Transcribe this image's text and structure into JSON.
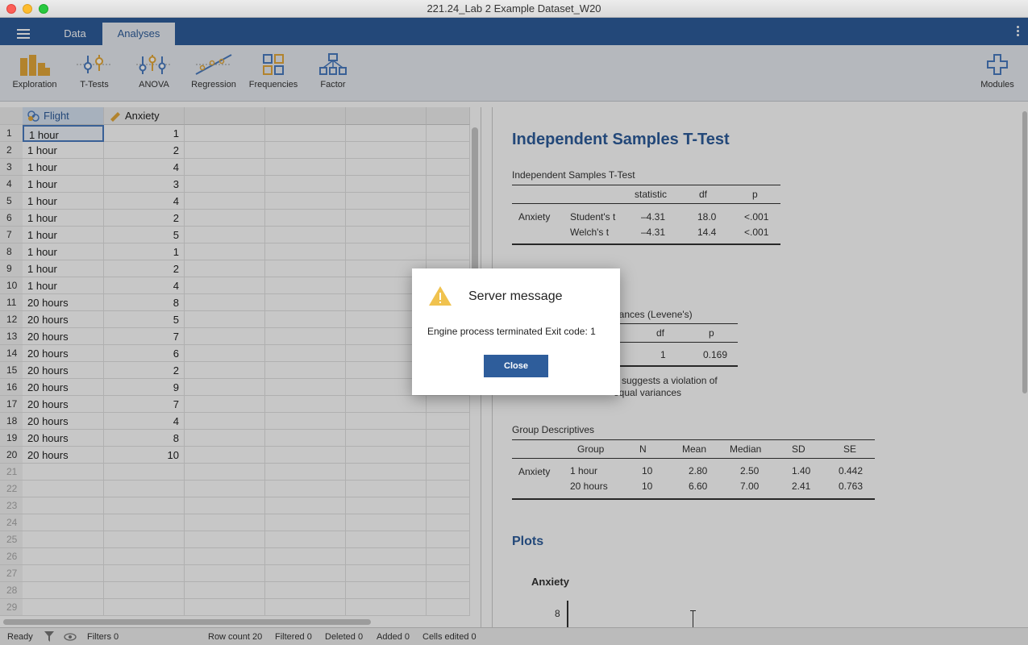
{
  "window": {
    "title": "221.24_Lab 2 Example Dataset_W20"
  },
  "tabs": [
    {
      "label": "Data"
    },
    {
      "label": "Analyses"
    }
  ],
  "ribbon": {
    "exploration": "Exploration",
    "ttests": "T-Tests",
    "anova": "ANOVA",
    "regression": "Regression",
    "frequencies": "Frequencies",
    "factor": "Factor",
    "modules": "Modules"
  },
  "sheet": {
    "columns": [
      "Flight",
      "Anxiety"
    ],
    "rows": [
      [
        "1 hour",
        "1"
      ],
      [
        "1 hour",
        "2"
      ],
      [
        "1 hour",
        "4"
      ],
      [
        "1 hour",
        "3"
      ],
      [
        "1 hour",
        "4"
      ],
      [
        "1 hour",
        "2"
      ],
      [
        "1 hour",
        "5"
      ],
      [
        "1 hour",
        "1"
      ],
      [
        "1 hour",
        "2"
      ],
      [
        "1 hour",
        "4"
      ],
      [
        "20 hours",
        "8"
      ],
      [
        "20 hours",
        "5"
      ],
      [
        "20 hours",
        "7"
      ],
      [
        "20 hours",
        "6"
      ],
      [
        "20 hours",
        "2"
      ],
      [
        "20 hours",
        "9"
      ],
      [
        "20 hours",
        "7"
      ],
      [
        "20 hours",
        "4"
      ],
      [
        "20 hours",
        "8"
      ],
      [
        "20 hours",
        "10"
      ]
    ],
    "row_numbers": [
      "1",
      "2",
      "3",
      "4",
      "5",
      "6",
      "7",
      "8",
      "9",
      "10",
      "11",
      "12",
      "13",
      "14",
      "15",
      "16",
      "17",
      "18",
      "19",
      "20",
      "21",
      "22",
      "23",
      "24",
      "25",
      "26",
      "27",
      "28",
      "29"
    ]
  },
  "status": {
    "ready": "Ready",
    "filters": "Filters 0",
    "row_count": "Row count 20",
    "filtered": "Filtered 0",
    "deleted": "Deleted 0",
    "added": "Added 0",
    "cells_edited": "Cells edited 0"
  },
  "results": {
    "title": "Independent Samples T-Test",
    "ttest": {
      "caption": "Independent Samples T-Test",
      "headers": [
        "statistic",
        "df",
        "p"
      ],
      "variable": "Anxiety",
      "rows": [
        {
          "test": "Student's t",
          "statistic": "–4.31",
          "df": "18.0",
          "p": "<.001"
        },
        {
          "test": "Welch's t",
          "statistic": "–4.31",
          "df": "14.4",
          "p": "<.001"
        }
      ]
    },
    "levene": {
      "caption_partial": "riances (Levene's)",
      "headers": [
        "df",
        "p"
      ],
      "df": "1",
      "p": "0.169",
      "note_line1": "e suggests a violation of",
      "note_line2": "equal variances"
    },
    "descriptives": {
      "caption": "Group Descriptives",
      "headers": [
        "Group",
        "N",
        "Mean",
        "Median",
        "SD",
        "SE"
      ],
      "variable": "Anxiety",
      "rows": [
        {
          "group": "1 hour",
          "n": "10",
          "mean": "2.80",
          "median": "2.50",
          "sd": "1.40",
          "se": "0.442"
        },
        {
          "group": "20 hours",
          "n": "10",
          "mean": "6.60",
          "median": "7.00",
          "sd": "2.41",
          "se": "0.763"
        }
      ]
    },
    "plots": {
      "title": "Plots",
      "plot_title": "Anxiety",
      "tick": "8"
    }
  },
  "dialog": {
    "title": "Server message",
    "message": "Engine process terminated Exit code: 1",
    "close_label": "Close"
  }
}
